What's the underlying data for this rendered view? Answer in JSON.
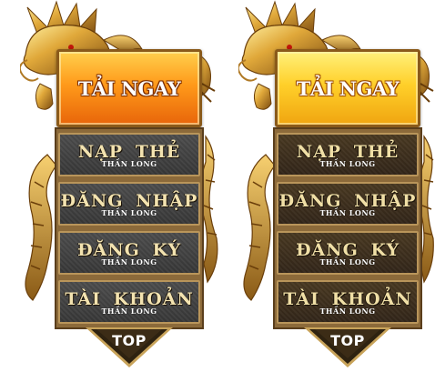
{
  "panels": [
    {
      "variant": "normal",
      "download": {
        "label": "TẢI NGAY"
      },
      "menu": [
        {
          "title": "NẠP THẺ",
          "subtitle": "THẦN LONG"
        },
        {
          "title": "ĐĂNG NHẬP",
          "subtitle": "THẦN LONG"
        },
        {
          "title": "ĐĂNG KÝ",
          "subtitle": "THẦN LONG"
        },
        {
          "title": "TÀI KHOẢN",
          "subtitle": "THẦN LONG"
        }
      ],
      "top": {
        "label": "TOP"
      }
    },
    {
      "variant": "hover",
      "download": {
        "label": "TẢI NGAY"
      },
      "menu": [
        {
          "title": "NẠP THẺ",
          "subtitle": "THẦN LONG"
        },
        {
          "title": "ĐĂNG NHẬP",
          "subtitle": "THẦN LONG"
        },
        {
          "title": "ĐĂNG KÝ",
          "subtitle": "THẦN LONG"
        },
        {
          "title": "TÀI KHOẢN",
          "subtitle": "THẦN LONG"
        }
      ],
      "top": {
        "label": "TOP"
      }
    }
  ],
  "colors": {
    "gold": "#c8962e",
    "gold_dark": "#7a4e12",
    "orange_button": "#ff9a1a",
    "yellow_button": "#ffd02a",
    "menu_gray": "#3f3f3f",
    "menu_brown": "#3d2f1e",
    "text_cream": "#f3e3b0",
    "top_arrow": "#3a2a14"
  },
  "icons": [
    "golden-dragon-icon"
  ]
}
